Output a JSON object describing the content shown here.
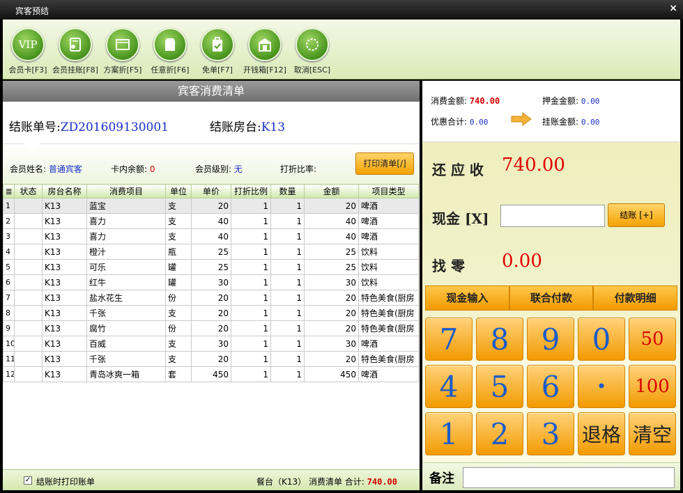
{
  "window": {
    "title": "宾客预结",
    "close_glyph": "×"
  },
  "toolbar": [
    {
      "label": "会员卡[F3]",
      "icon": "vip-icon",
      "glyph": "VIP"
    },
    {
      "label": "会员挂账[F8]",
      "icon": "member-credit-icon",
      "glyph": ""
    },
    {
      "label": "方案折[F5]",
      "icon": "plan-discount-icon",
      "glyph": ""
    },
    {
      "label": "任意折[F6]",
      "icon": "custom-discount-icon",
      "glyph": ""
    },
    {
      "label": "免单[F7]",
      "icon": "free-bill-icon",
      "glyph": ""
    },
    {
      "label": "开钱箱[F12]",
      "icon": "cash-drawer-icon",
      "glyph": ""
    },
    {
      "label": "取消[ESC]",
      "icon": "cancel-icon",
      "glyph": ""
    }
  ],
  "bill": {
    "header": "宾客消费清单",
    "bill_no_label": "结账单号:",
    "bill_no": "ZD201609130001",
    "room_label": "结账房台:",
    "room": "K13",
    "member_name_label": "会员姓名:",
    "member_name": "普通宾客",
    "card_balance_label": "卡内余额:",
    "card_balance": "0",
    "member_level_label": "会员级别:",
    "member_level": "无",
    "discount_rate_label": "打折比率:",
    "discount_rate": "",
    "print_button": "打印清单[/]",
    "columns": [
      "≣",
      "状态",
      "房台名称",
      "消费项目",
      "单位",
      "单价",
      "打折比例",
      "数量",
      "金额",
      "项目类型"
    ],
    "rows": [
      [
        "1",
        "",
        "K13",
        "蓝宝",
        "支",
        "20",
        "1",
        "1",
        "20",
        "啤酒"
      ],
      [
        "2",
        "",
        "K13",
        "喜力",
        "支",
        "40",
        "1",
        "1",
        "40",
        "啤酒"
      ],
      [
        "3",
        "",
        "K13",
        "喜力",
        "支",
        "40",
        "1",
        "1",
        "40",
        "啤酒"
      ],
      [
        "4",
        "",
        "K13",
        "橙汁",
        "瓶",
        "25",
        "1",
        "1",
        "25",
        "饮料"
      ],
      [
        "5",
        "",
        "K13",
        "可乐",
        "罐",
        "25",
        "1",
        "1",
        "25",
        "饮料"
      ],
      [
        "6",
        "",
        "K13",
        "红牛",
        "罐",
        "30",
        "1",
        "1",
        "30",
        "饮料"
      ],
      [
        "7",
        "",
        "K13",
        "盐水花生",
        "份",
        "20",
        "1",
        "1",
        "20",
        "特色美食(厨房"
      ],
      [
        "8",
        "",
        "K13",
        "千张",
        "支",
        "20",
        "1",
        "1",
        "20",
        "特色美食(厨房"
      ],
      [
        "9",
        "",
        "K13",
        "腐竹",
        "份",
        "20",
        "1",
        "1",
        "20",
        "特色美食(厨房"
      ],
      [
        "10",
        "",
        "K13",
        "百威",
        "支",
        "30",
        "1",
        "1",
        "30",
        "啤酒"
      ],
      [
        "11",
        "",
        "K13",
        "千张",
        "支",
        "20",
        "1",
        "1",
        "20",
        "特色美食(厨房"
      ],
      [
        "12",
        "",
        "K13",
        "青岛冰爽一箱",
        "套",
        "450",
        "1",
        "1",
        "450",
        "啤酒"
      ]
    ],
    "print_on_settle_label": "结账时打印账单",
    "print_on_settle_checked": "✓",
    "footer_summary": "餐台（K13） 消费清单 合计:",
    "footer_total": "740.00"
  },
  "payment": {
    "consume_label": "消费金额:",
    "consume_value": "740.00",
    "deposit_label": "押金金额:",
    "deposit_value": "0.00",
    "discount_label": "优惠合计:",
    "discount_value": "0.00",
    "credit_label": "挂账金额:",
    "credit_value": "0.00",
    "due_label": "还 应 收",
    "due_value": "740.00",
    "cash_label": "现金 [X]",
    "cash_value": "",
    "settle_button": "结账 [+]",
    "change_label": "找    零",
    "change_value": "0.00",
    "tabs": [
      "现金输入",
      "联合付款",
      "付款明细"
    ],
    "keypad": [
      "7",
      "8",
      "9",
      "0",
      "50",
      "4",
      "5",
      "6",
      "•",
      "100",
      "1",
      "2",
      "3",
      "退格",
      "清空"
    ],
    "remark_label": "备注",
    "remark_value": ""
  },
  "colors": {
    "accent_orange": "#f5a200",
    "value_red": "#e00000",
    "value_blue": "#1830c8",
    "toolbar_green": "#4e9a22"
  }
}
